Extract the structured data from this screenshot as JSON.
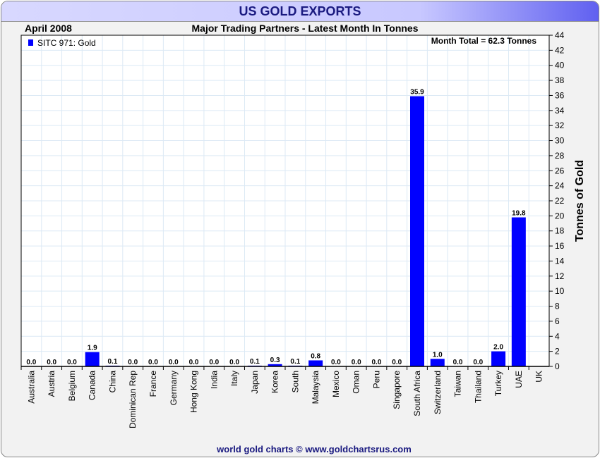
{
  "chart_data": {
    "type": "bar",
    "title": "US GOLD EXPORTS",
    "subtitle": "Major Trading Partners - Latest Month In Tonnes",
    "period": "April 2008",
    "annotation": "Month Total = 62.3 Tonnes",
    "legend": {
      "label": "SITC 971: Gold",
      "placement": "top-left"
    },
    "ylabel": "Tonnes of Gold",
    "ylim": [
      0,
      44
    ],
    "ytick_step": 2,
    "grid": true,
    "footer": "world gold charts © www.goldchartsrus.com",
    "bar_color": "#0000ff",
    "categories": [
      "Australia",
      "Austria",
      "Belgium",
      "Canada",
      "China",
      "Dominican Rep",
      "France",
      "Germany",
      "Hong Kong",
      "India",
      "Italy",
      "Japan",
      "Korea",
      "South",
      "Malaysia",
      "Mexico",
      "Oman",
      "Peru",
      "Singapore",
      "South Africa",
      "Switzerland",
      "Taiwan",
      "Thailand",
      "Turkey",
      "UAE",
      "UK"
    ],
    "values": [
      0.0,
      0.0,
      0.0,
      1.9,
      0.1,
      0.0,
      0.0,
      0.0,
      0.0,
      0.0,
      0.0,
      0.1,
      0.3,
      0.1,
      0.8,
      0.0,
      0.0,
      0.0,
      0.0,
      35.9,
      1.0,
      0.0,
      0.0,
      2.0,
      19.8,
      null
    ]
  }
}
